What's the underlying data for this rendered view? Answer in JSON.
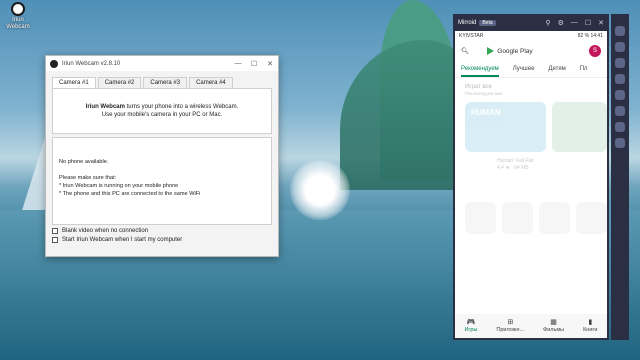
{
  "desktop": {
    "icon_label": "Iriun Webcam"
  },
  "iriun": {
    "title": "Iriun Webcam v2.8.10",
    "tabs": [
      "Camera #1",
      "Camera #2",
      "Camera #3",
      "Camera #4"
    ],
    "info_bold": "Iriun Webcam",
    "info_line1_rest": " turns your phone into a wireless Webcam.",
    "info_line2": "Use your mobile's camera in your PC or Mac.",
    "status": {
      "line1": "No phone available.",
      "line2": "Please make sure that:",
      "line3": "* Iriun Webcam is running on your mobile phone",
      "line4": "* The phone and this PC are connected to the same WiFi"
    },
    "options": {
      "blank_video": "Blank video when no connection",
      "start_with_computer": "Start Iriun Webcam when I start my computer"
    }
  },
  "mirroid": {
    "title": "Mirroid",
    "badge": "Beta",
    "statusbar": {
      "carrier": "KYIVSTAR",
      "right": "82 % 14:41"
    },
    "search": {
      "app_name": "Google Play",
      "avatar_letter": "S"
    },
    "tabs": [
      "Рекомендуем",
      "Лучшее",
      "Детям",
      "Пл"
    ],
    "section_title": "Играт все",
    "section_sub": "Рекомендуем вам",
    "card_text": "HUMAN",
    "game_meta": {
      "name": "Human: Fall Flat",
      "rating": "4,4 ★  ·  64 МБ"
    },
    "bottom_nav": [
      {
        "icon": "gamepad-icon",
        "glyph": "🎮",
        "label": "Игры"
      },
      {
        "icon": "apps-icon",
        "glyph": "⊞",
        "label": "Приложе..."
      },
      {
        "icon": "movie-icon",
        "glyph": "▦",
        "label": "Фильмы"
      },
      {
        "icon": "book-icon",
        "glyph": "▮",
        "label": "Книги"
      }
    ]
  }
}
